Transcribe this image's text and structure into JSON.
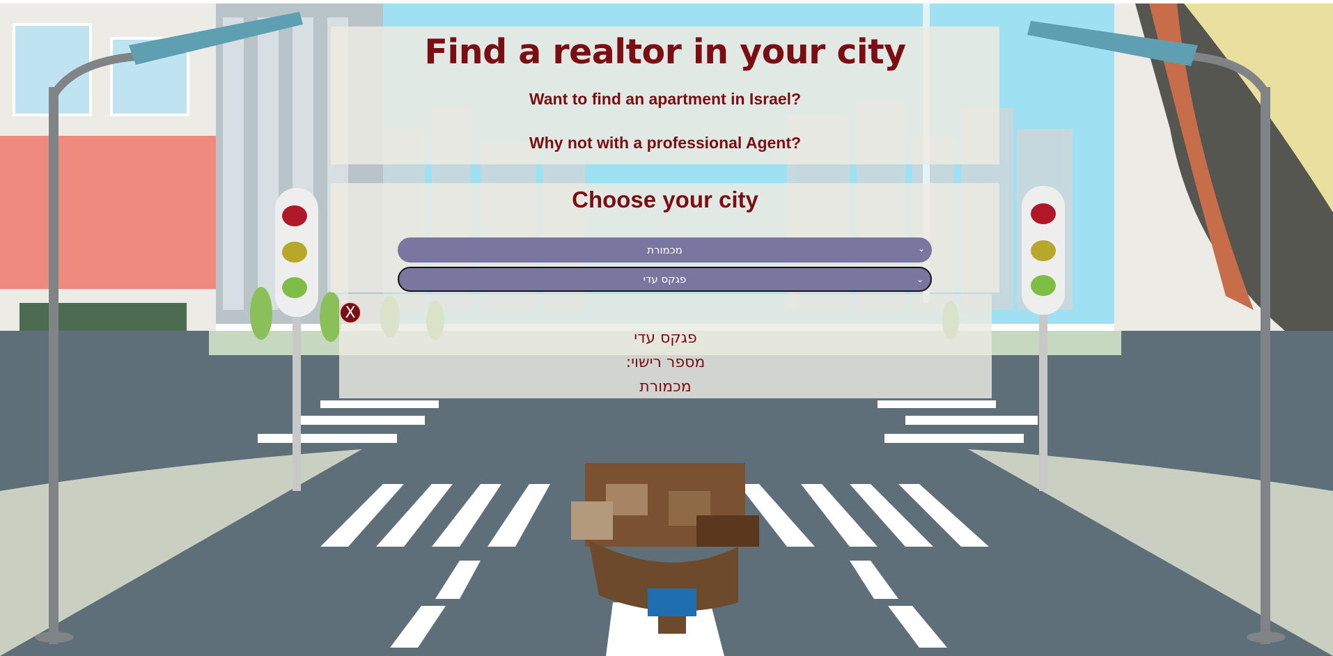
{
  "header": {
    "title": "Find a realtor in your city",
    "subtitle_1": "Want to find an apartment in Israel?",
    "subtitle_2": "Why not with a professional Agent?"
  },
  "city_selector": {
    "heading": "Choose your city",
    "city_select_value": "מכמורת",
    "agent_select_value": "פגקס עדי"
  },
  "agent_card": {
    "close_label": "X",
    "name": "פגקס עדי",
    "license_label": "מספר רישוי:",
    "city": "מכמורת"
  },
  "colors": {
    "accent": "#7a0e12",
    "select_bg": "#7a76a0",
    "panel_bg": "#ecebe2"
  }
}
